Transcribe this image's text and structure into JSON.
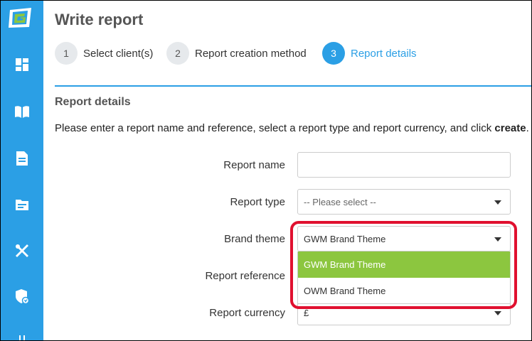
{
  "colors": {
    "sidebar": "#2b9fe5",
    "accent": "#2b9fe5",
    "selected_option": "#8cc63f",
    "highlight": "#e0102f"
  },
  "sidebar": {
    "icons": [
      "dashboard-icon",
      "book-icon",
      "document-icon",
      "folder-icon",
      "tools-icon",
      "shield-icon"
    ]
  },
  "page": {
    "title": "Write report"
  },
  "steps": [
    {
      "number": "1",
      "label": "Select client(s)"
    },
    {
      "number": "2",
      "label": "Report creation method"
    },
    {
      "number": "3",
      "label": "Report details",
      "active": true
    }
  ],
  "section": {
    "title": "Report details",
    "instructions_pre": "Please enter a report name and reference, select a report type and report currency, and click ",
    "instructions_bold": "create",
    "instructions_post": "."
  },
  "form": {
    "report_name": {
      "label": "Report name",
      "value": ""
    },
    "report_type": {
      "label": "Report type",
      "value": "-- Please select --"
    },
    "brand_theme": {
      "label": "Brand theme",
      "value": "GWM Brand Theme",
      "options": [
        "GWM Brand Theme",
        "OWM Brand Theme"
      ]
    },
    "report_reference": {
      "label": "Report reference"
    },
    "report_currency": {
      "label": "Report currency",
      "value": "£"
    }
  }
}
